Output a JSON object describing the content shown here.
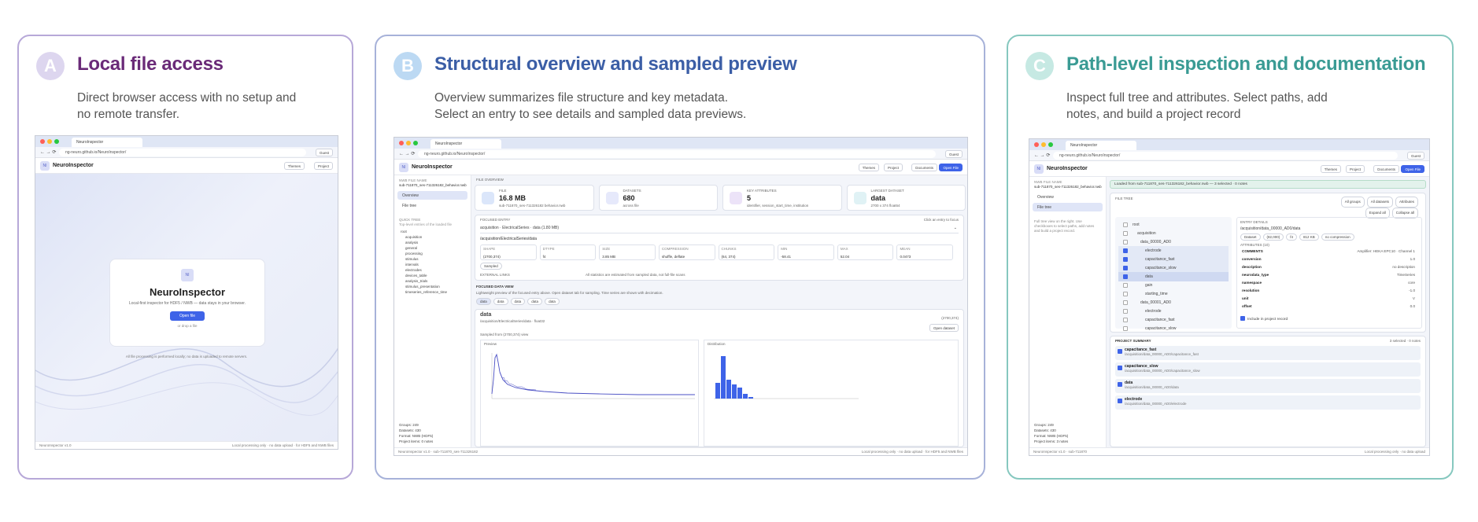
{
  "panels": [
    {
      "letter": "A",
      "title": "Local file access",
      "subtitle": [
        "Direct browser access with no setup and",
        "no remote transfer."
      ]
    },
    {
      "letter": "B",
      "title": "Structural overview and sampled preview",
      "subtitle": [
        "Overview summarizes file structure and key metadata.",
        "Select an entry to see details and sampled data previews."
      ]
    },
    {
      "letter": "C",
      "title": "Path-level inspection and documentation",
      "subtitle": [
        "Inspect full tree and attributes. Select paths, add",
        "notes, and build a project record"
      ]
    }
  ],
  "browser": {
    "tab_label": "NeuroInspector",
    "url": "ng-neuro.github.io/NeuroInspector/",
    "guest": "Guest"
  },
  "app": {
    "name": "NeuroInspector",
    "logo": "NI",
    "header_buttons": [
      "Themes",
      "Project",
      "Documents",
      "Open File"
    ]
  },
  "shotA": {
    "card_title": "NeuroInspector",
    "card_text": "Local-first inspector for HDF5 / NWB — data stays in your browser.",
    "open_button": "Open file",
    "card_note": "or drop a file",
    "footnote": "All file processing is performed locally; no data is uploaded to remote servers.",
    "footer_left": "NeuroInspector v1.0",
    "footer_right": "Local processing only · no data upload · for HDF5 and NWB files"
  },
  "shotB": {
    "file_label": "NWB FILE NAME",
    "file_name": "sub-711870_ses-711326182_behavior.nwb",
    "nav": [
      "Overview",
      "File tree"
    ],
    "quick_tree_label": "QUICK TREE",
    "quick_tree_hint": "Top-level entries of the loaded file",
    "tree": [
      "root",
      "acquisition",
      "analysis",
      "general",
      "processing",
      "stimulus",
      "intervals",
      "electrodes",
      "devices_table",
      "analysis_trials",
      "stimulus_presentation",
      "timeseries_reference_time"
    ],
    "stats": [
      "Groups: 249",
      "Datasets: 430",
      "Format: NWB (HDF5)",
      "Project items: 0 notes"
    ],
    "overview_label": "FILE OVERVIEW",
    "cards": [
      {
        "label": "FILE",
        "value": "16.8 MB",
        "note": "sub-711870_ses-711326182 behavior.nwb"
      },
      {
        "label": "DATASETS",
        "value": "680",
        "note": "across file"
      },
      {
        "label": "KEY ATTRIBUTES",
        "value": "5",
        "note": "identifier, session_start_time, institution"
      },
      {
        "label": "LARGEST DATASET",
        "value": "data",
        "note": "2700 x 374 float64"
      }
    ],
    "focused_label": "FOCUSED ENTRY",
    "focused_path": "/acquisition/ElectricalSeries/data",
    "focused_hint": "Click an entry to focus",
    "focused_select": "acquisition · ElectricalSeries · data (1.80 MB)",
    "focused_cells": [
      {
        "k": "SHAPE",
        "v": "(2700,374)"
      },
      {
        "k": "DTYPE",
        "v": "f4"
      },
      {
        "k": "SIZE",
        "v": "3.85 MB"
      },
      {
        "k": "COMPRESSION",
        "v": "shuffle, deflate"
      },
      {
        "k": "CHUNKS",
        "v": "(64, 374)"
      },
      {
        "k": "MIN",
        "v": "-58.41"
      },
      {
        "k": "MAX",
        "v": "52.04"
      },
      {
        "k": "MEAN",
        "v": "0.0473"
      }
    ],
    "tag": "Sampled",
    "footnote_left": "EXTERNAL LINKS",
    "footnote_right": "All statistics are estimated from sampled data, not full-file scans",
    "preview_label": "FOCUSED DATA VIEW",
    "preview_hint": "Lightweight preview of the focused entry above. Open dataset tab for sampling. Time series are shown with decimation.",
    "preview_tabs": [
      "data",
      "data",
      "data",
      "data",
      "data"
    ],
    "plot_title": "data",
    "plot_sub": "/acquisition/ElectricalSeries/data · float32",
    "plot_size": "(2700,374)",
    "plot_button": "Open dataset",
    "plot_note": "Sampled from (2700,374) view",
    "line_title": "Preview",
    "hist_title": "Distribution",
    "footer_left": "NeuroInspector v1.0 · sub-711870_ses-711326182",
    "footer_right": "Local processing only · no data upload · for HDF5 and NWB files"
  },
  "shotC": {
    "banner": "Loaded from sub-711870_ses-711326182_behavior.nwb — 3 selected · 0 notes",
    "tree_label": "FILE TREE",
    "tree_buttons": [
      "All groups",
      "All datasets",
      "Attributes",
      "Expand all",
      "Collapse all"
    ],
    "tree_rows": [
      {
        "t": "root",
        "on": false
      },
      {
        "t": "acquisition",
        "on": false
      },
      {
        "t": "data_00000_AD0",
        "on": false
      },
      {
        "t": "electrode",
        "on": true
      },
      {
        "t": "capacitance_fast",
        "on": true
      },
      {
        "t": "capacitance_slow",
        "on": true
      },
      {
        "t": "data",
        "on": true
      },
      {
        "t": "gain",
        "on": false
      },
      {
        "t": "starting_time",
        "on": false
      },
      {
        "t": "data_00001_AD0",
        "on": false
      },
      {
        "t": "electrode",
        "on": false
      },
      {
        "t": "capacitance_fast",
        "on": false
      },
      {
        "t": "capacitance_slow",
        "on": false
      }
    ],
    "details_label": "ENTRY DETAILS",
    "details_path": "/acquisition/data_00000_AD0/data",
    "details_tags": [
      "Dataset",
      "(82,000)",
      "f4",
      "812 KB",
      "no compression"
    ],
    "attr_label": "ATTRIBUTES (10)",
    "attrs": [
      {
        "k": "COMMENTS",
        "v": "Amplifier: HEKA EPC10 · Channel 1"
      },
      {
        "k": "conversion",
        "v": "1.0"
      },
      {
        "k": "description",
        "v": "no description"
      },
      {
        "k": "neurodata_type",
        "v": "TimeSeries"
      },
      {
        "k": "namespace",
        "v": "core"
      },
      {
        "k": "resolution",
        "v": "-1.0"
      },
      {
        "k": "unit",
        "v": "V"
      },
      {
        "k": "offset",
        "v": "0.0"
      }
    ],
    "include_label": "Include in project record",
    "summary_label": "PROJECT SUMMARY",
    "summary_count": "3 selected · 0 notes",
    "summary_items": [
      {
        "name": "capacitance_fast",
        "path": "/acquisition/data_00000_AD0/capacitance_fast"
      },
      {
        "name": "capacitance_slow",
        "path": "/acquisition/data_00000_AD0/capacitance_slow"
      },
      {
        "name": "data",
        "path": "/acquisition/data_00000_AD0/data"
      },
      {
        "name": "electrode",
        "path": "/acquisition/data_00000_AD0/electrode"
      }
    ],
    "side_hint": "Full tree view on the right. Use checkboxes to select paths, add notes and build a project record.",
    "stats": [
      "Groups: 249",
      "Datasets: 430",
      "Format: NWB (HDF5)",
      "Project items: 3 notes"
    ],
    "footer_left": "NeuroInspector v1.0 · sub-711870",
    "footer_right": "Local processing only · no data upload"
  },
  "colors": {
    "accent": "#3e63e8",
    "panelA": "#b7a8d8",
    "panelB": "#a7b2d9",
    "panelC": "#86c8bf"
  }
}
